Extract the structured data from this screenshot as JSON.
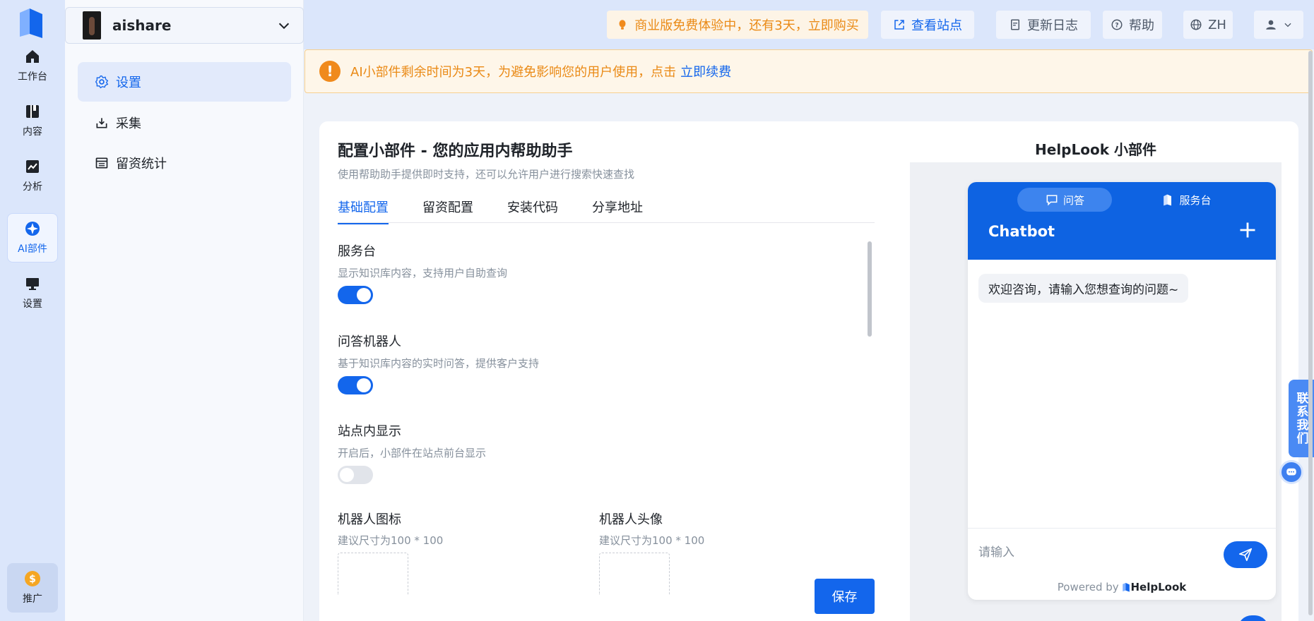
{
  "workspace": {
    "name": "aishare"
  },
  "rail": {
    "items": [
      {
        "label": "工作台",
        "icon": "home-icon"
      },
      {
        "label": "内容",
        "icon": "book-icon"
      },
      {
        "label": "分析",
        "icon": "chart-icon"
      },
      {
        "label": "AI部件",
        "icon": "ai-widget-icon"
      },
      {
        "label": "设置",
        "icon": "monitor-icon"
      }
    ],
    "promo": {
      "label": "推广",
      "icon": "coin-icon"
    }
  },
  "subnav": {
    "items": [
      {
        "label": "设置",
        "icon": "gear-icon",
        "active": true
      },
      {
        "label": "采集",
        "icon": "inbox-download-icon"
      },
      {
        "label": "留资统计",
        "icon": "list-table-icon"
      }
    ]
  },
  "topbar": {
    "trial": "商业版免费体验中，还有3天，立即购买",
    "view_site": "查看站点",
    "changelog": "更新日志",
    "help": "帮助",
    "lang": "ZH"
  },
  "notice": {
    "text": "AI小部件剩余时间为3天，为避免影响您的用户使用，点击",
    "link": "立即续费"
  },
  "config": {
    "title": "配置小部件 - 您的应用内帮助助手",
    "subtitle": "使用帮助助手提供即时支持，还可以允许用户进行搜索快速查找",
    "tabs": [
      "基础配置",
      "留资配置",
      "安装代码",
      "分享地址"
    ],
    "active_tab": "基础配置",
    "settings": [
      {
        "label": "服务台",
        "desc": "显示知识库内容，支持用户自助查询",
        "enabled": true
      },
      {
        "label": "问答机器人",
        "desc": "基于知识库内容的实时问答，提供客户支持",
        "enabled": true
      },
      {
        "label": "站点内显示",
        "desc": "开启后，小部件在站点前台显示",
        "enabled": false
      }
    ],
    "uploads": [
      {
        "label": "机器人图标",
        "hint": "建议尺寸为100 * 100"
      },
      {
        "label": "机器人头像",
        "hint": "建议尺寸为100 * 100"
      }
    ],
    "save_label": "保存"
  },
  "preview": {
    "title": "HelpLook 小部件",
    "tabs": [
      "问答",
      "服务台"
    ],
    "chat_title": "Chatbot",
    "welcome": "欢迎咨询，请输入您想查询的问题~",
    "input_placeholder": "请输入",
    "powered_prefix": "Powered by",
    "powered_brand": "HelpLook"
  },
  "contact": {
    "label": "联系我们"
  },
  "colors": {
    "accent": "#1366ec",
    "warning": "#ea8a16",
    "header": "#0e63e2"
  }
}
